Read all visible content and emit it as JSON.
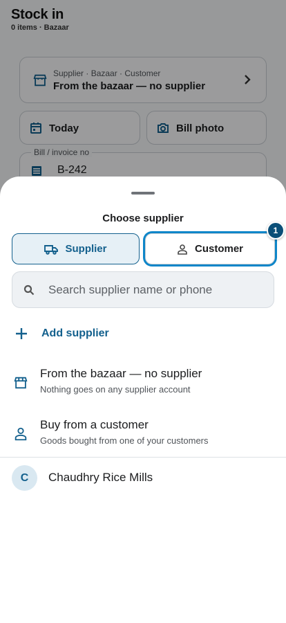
{
  "background": {
    "title": "Stock in",
    "subtitle": "0 items · Bazaar",
    "supplier_card": {
      "meta": "Supplier · Bazaar · Customer",
      "value": "From the bazaar — no supplier"
    },
    "date_button": "Today",
    "photo_button": "Bill photo",
    "bill_field": {
      "label": "Bill / invoice no",
      "value": "B-242"
    }
  },
  "sheet": {
    "title": "Choose supplier",
    "segments": [
      {
        "label": "Supplier",
        "icon": "truck-icon",
        "selected": true
      },
      {
        "label": "Customer",
        "icon": "person-icon",
        "selected": false
      }
    ],
    "badge": "1",
    "search": {
      "placeholder": "Search supplier name or phone",
      "value": ""
    },
    "add_label": "Add supplier",
    "options": [
      {
        "title": "From the bazaar — no supplier",
        "subtitle": "Nothing goes on any supplier account",
        "icon": "store-icon"
      },
      {
        "title": "Buy from a customer",
        "subtitle": "Goods bought from one of your customers",
        "icon": "person-icon"
      }
    ],
    "suppliers": [
      {
        "initial": "C",
        "name": "Chaudhry Rice Mills"
      }
    ]
  },
  "colors": {
    "accent": "#13608d",
    "accent_light": "#e6f0f6",
    "focus_ring": "#0e86c9",
    "badge": "#0b4f78",
    "scrim": "rgba(0,0,0,0.38)"
  }
}
